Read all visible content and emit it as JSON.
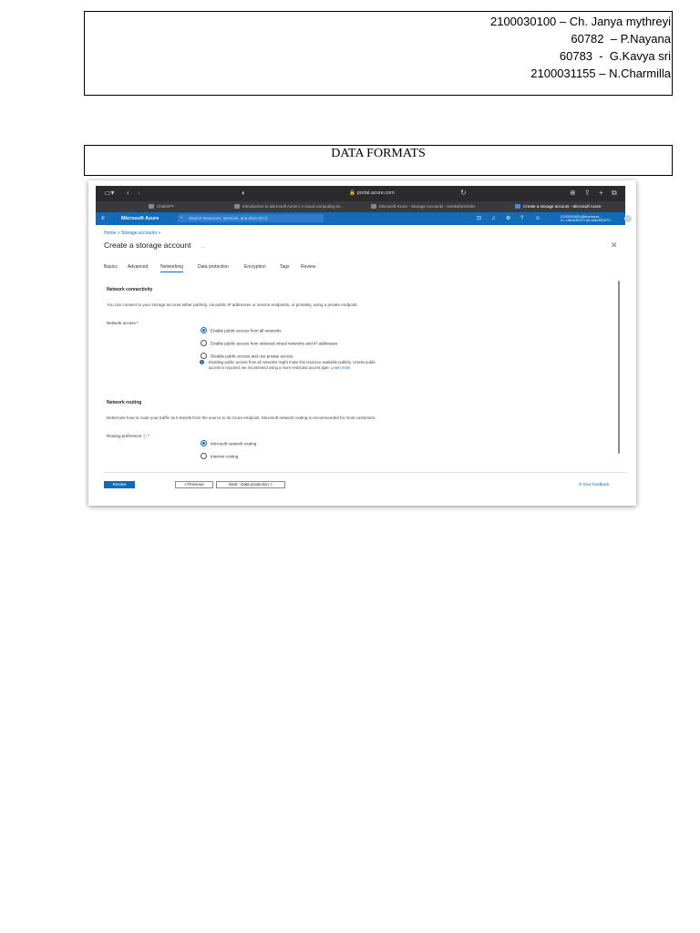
{
  "header": {
    "members": [
      "2100030100 – Ch. Janya mythreyi",
      "60782  – P.Nayana",
      "60783  -  G.Kavya sri",
      "2100031155 – N.Charmilla"
    ],
    "title": "DATA FORMATS"
  },
  "browser": {
    "url": "portal.azure.com",
    "tabs": [
      "ChatGPT",
      "Introduction to Microsoft Azure | A cloud computing se...",
      "Microsoft Azure - Storage Accounts - GeeksforGeeks",
      "Create a storage account - Microsoft Azure"
    ]
  },
  "azure": {
    "brand": "Microsoft Azure",
    "search_placeholder": "Search resources, services, and docs (G+/)",
    "user_email": "2100030831@klunivers...",
    "user_org": "K L UNIVERSITY (KLUNIVERSITY...",
    "breadcrumb": "Home  >  Storage accounts  >",
    "page_title": "Create a storage account",
    "page_title_more": "...",
    "tabs": [
      "Basics",
      "Advanced",
      "Networking",
      "Data protection",
      "Encryption",
      "Tags",
      "Review"
    ],
    "active_tab": "Networking",
    "connectivity": {
      "title": "Network connectivity",
      "description": "You can connect to your storage account either publicly, via public IP addresses or service endpoints, or privately, using a private endpoint.",
      "label": "Network access *",
      "options": [
        "Enable public access from all networks",
        "Enable public access from selected virtual networks and IP addresses",
        "Disable public access and use private access"
      ],
      "selected_index": 0,
      "info": "Enabling public access from all networks might make this resource available publicly. Unless public access is required, we recommend using a more restricted access type.",
      "info_link": "Learn more"
    },
    "routing": {
      "title": "Network routing",
      "description": "Determine how to route your traffic as it travels from the source to its Azure endpoint. Microsoft network routing is recommended for most customers.",
      "label": "Routing preference  ⓘ  *",
      "options": [
        "Microsoft network routing",
        "Internet routing"
      ],
      "selected_index": 0
    },
    "footer": {
      "review": "Review",
      "previous": "< Previous",
      "next": "Next : Data protection >",
      "feedback": "Give feedback"
    }
  },
  "colors": {
    "azure_blue": "#0f6cbd",
    "browser_dark": "#2b2b2d"
  }
}
